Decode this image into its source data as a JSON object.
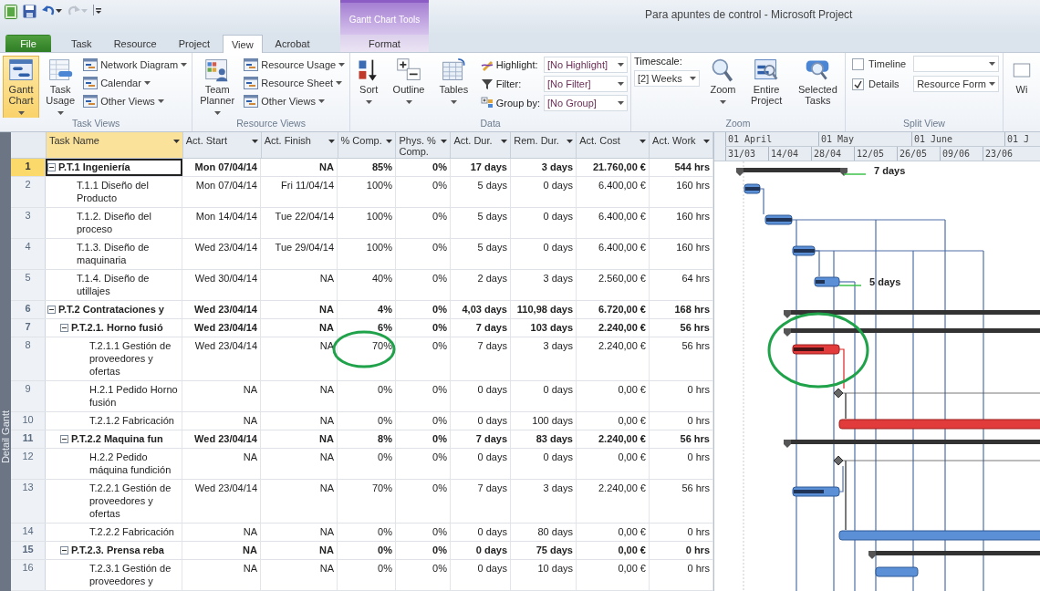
{
  "window": {
    "title": "Para apuntes de control - Microsoft Project"
  },
  "quick_access": [
    {
      "kind": "app",
      "disabled": false
    },
    {
      "kind": "save",
      "disabled": false
    },
    {
      "kind": "undo",
      "disabled": false
    },
    {
      "kind": "redo",
      "disabled": true
    },
    {
      "kind": "customize",
      "disabled": false
    }
  ],
  "context_tabs": {
    "title": "Gantt Chart Tools",
    "tabs": [
      {
        "label": "Format",
        "selected": false
      }
    ]
  },
  "tabs": [
    {
      "label": "File",
      "kind": "file",
      "selected": false
    },
    {
      "label": "Task",
      "kind": "tab",
      "selected": false
    },
    {
      "label": "Resource",
      "kind": "tab",
      "selected": false
    },
    {
      "label": "Project",
      "kind": "tab",
      "selected": false
    },
    {
      "label": "View",
      "kind": "tab",
      "selected": true
    },
    {
      "label": "Acrobat",
      "kind": "tab",
      "selected": false
    }
  ],
  "ribbon": {
    "groups": [
      {
        "label": "Task Views",
        "items": [
          {
            "kind": "large",
            "label": "Gantt Chart",
            "dropdown": true,
            "selected": true
          },
          {
            "kind": "large",
            "label": "Task Usage",
            "dropdown": true,
            "selected": false
          },
          {
            "kind": "stack",
            "items": [
              {
                "label": "Network Diagram",
                "dropdown": true
              },
              {
                "label": "Calendar",
                "dropdown": true
              },
              {
                "label": "Other Views",
                "dropdown": true
              }
            ]
          }
        ]
      },
      {
        "label": "Resource Views",
        "items": [
          {
            "kind": "large",
            "label": "Team Planner",
            "dropdown": true,
            "selected": false
          },
          {
            "kind": "stack",
            "items": [
              {
                "label": "Resource Usage",
                "dropdown": true
              },
              {
                "label": "Resource Sheet",
                "dropdown": true
              },
              {
                "label": "Other Views",
                "dropdown": true
              }
            ]
          }
        ]
      },
      {
        "label": "Data",
        "items": [
          {
            "kind": "large",
            "label": "Sort",
            "dropdown": true,
            "selected": false
          },
          {
            "kind": "large",
            "label": "Outline",
            "dropdown": true,
            "selected": false
          },
          {
            "kind": "large",
            "label": "Tables",
            "dropdown": true,
            "selected": false
          },
          {
            "kind": "fields",
            "items": [
              {
                "label": "Highlight:",
                "value": "[No Highlight]"
              },
              {
                "label": "Filter:",
                "value": "[No Filter]"
              },
              {
                "label": "Group by:",
                "value": "[No Group]"
              }
            ]
          }
        ]
      },
      {
        "label": "Zoom",
        "items": [
          {
            "kind": "field_stacked",
            "label": "Timescale:",
            "value": "[2] Weeks"
          },
          {
            "kind": "large",
            "label": "Zoom",
            "dropdown": true,
            "selected": false
          },
          {
            "kind": "large",
            "label": "Entire Project",
            "dropdown": false,
            "selected": false
          },
          {
            "kind": "large",
            "label": "Selected Tasks",
            "dropdown": false,
            "selected": false
          }
        ]
      },
      {
        "label": "Split View",
        "items": [
          {
            "kind": "checks",
            "items": [
              {
                "label": "Timeline",
                "checked": false
              },
              {
                "label": "Details",
                "checked": true,
                "value": "Resource Form"
              }
            ]
          }
        ]
      },
      {
        "items": [
          {
            "kind": "large",
            "label": "Wi",
            "dropdown": false,
            "selected": false
          }
        ]
      }
    ]
  },
  "view_bar": {
    "label": "Detail Gantt"
  },
  "table": {
    "columns": [
      {
        "label": "Task Name",
        "selected": true
      },
      {
        "label": "Act. Start",
        "selected": false
      },
      {
        "label": "Act. Finish",
        "selected": false
      },
      {
        "label": "% Comp.",
        "selected": false
      },
      {
        "label": "Phys. % Comp.",
        "selected": false
      },
      {
        "label": "Act. Dur.",
        "selected": false
      },
      {
        "label": "Rem. Dur.",
        "selected": false
      },
      {
        "label": "Act. Cost",
        "selected": false
      },
      {
        "label": "Act. Work",
        "selected": false
      }
    ],
    "rows": [
      {
        "number": "1",
        "cells": [
          "P.T.1 Ingeniería",
          "Mon 07/04/14",
          "NA",
          "85%",
          "0%",
          "17 days",
          "3 days",
          "21.760,00 €",
          "544 hrs"
        ],
        "selected": true,
        "expanded": true,
        "bar": {
          "kind": "summary",
          "critical": false,
          "label": "7 days"
        },
        "children": [
          {
            "number": "2",
            "cells": [
              "T.1.1 Diseño del Producto",
              "Mon 07/04/14",
              "Fri 11/04/14",
              "100%",
              "0%",
              "5 days",
              "0 days",
              "6.400,00 €",
              "160 hrs"
            ],
            "selected": false,
            "bar": {
              "kind": "task",
              "critical": false
            }
          },
          {
            "number": "3",
            "cells": [
              "T.1.2. Diseño del proceso",
              "Mon 14/04/14",
              "Tue 22/04/14",
              "100%",
              "0%",
              "5 days",
              "0 days",
              "6.400,00 €",
              "160 hrs"
            ],
            "selected": false,
            "bar": {
              "kind": "task",
              "critical": false
            }
          },
          {
            "number": "4",
            "cells": [
              "T.1.3. Diseño de maquinaria",
              "Wed 23/04/14",
              "Tue 29/04/14",
              "100%",
              "0%",
              "5 days",
              "0 days",
              "6.400,00 €",
              "160 hrs"
            ],
            "selected": false,
            "bar": {
              "kind": "task",
              "critical": false
            }
          },
          {
            "number": "5",
            "cells": [
              "T.1.4. Diseño de utillajes",
              "Wed 30/04/14",
              "NA",
              "40%",
              "0%",
              "2 days",
              "3 days",
              "2.560,00 €",
              "64 hrs"
            ],
            "selected": false,
            "bar": {
              "kind": "task",
              "critical": false,
              "label": "5 days"
            }
          }
        ]
      },
      {
        "number": "6",
        "cells": [
          "P.T.2 Contrataciones y",
          "Wed 23/04/14",
          "NA",
          "4%",
          "0%",
          "4,03 days",
          "110,98 days",
          "6.720,00 €",
          "168 hrs"
        ],
        "selected": false,
        "expanded": true,
        "bar": {
          "kind": "summary",
          "critical": false
        },
        "children": [
          {
            "number": "7",
            "cells": [
              "P.T.2.1. Horno fusió",
              "Wed 23/04/14",
              "NA",
              "6%",
              "0%",
              "7 days",
              "103 days",
              "2.240,00 €",
              "56 hrs"
            ],
            "selected": false,
            "expanded": true,
            "bar": {
              "kind": "summary",
              "critical": false
            },
            "children": [
              {
                "number": "8",
                "cells": [
                  "T.2.1.1 Gestión de proveedores y ofertas",
                  "Wed 23/04/14",
                  "NA",
                  "70%",
                  "0%",
                  "7 days",
                  "3 days",
                  "2.240,00 €",
                  "56 hrs"
                ],
                "selected": false,
                "circled": true,
                "bar": {
                  "kind": "task",
                  "critical": true,
                  "circled": true
                }
              },
              {
                "number": "9",
                "cells": [
                  "H.2.1 Pedido Horno fusión",
                  "NA",
                  "NA",
                  "0%",
                  "0%",
                  "0 days",
                  "0 days",
                  "0,00 €",
                  "0 hrs"
                ],
                "selected": false,
                "bar": {
                  "kind": "milestone",
                  "critical": false
                }
              },
              {
                "number": "10",
                "cells": [
                  "T.2.1.2 Fabricación",
                  "NA",
                  "NA",
                  "0%",
                  "0%",
                  "0 days",
                  "100 days",
                  "0,00 €",
                  "0 hrs"
                ],
                "selected": false,
                "bar": {
                  "kind": "task",
                  "critical": true
                }
              }
            ]
          },
          {
            "number": "11",
            "cells": [
              "P.T.2.2 Maquina fun",
              "Wed 23/04/14",
              "NA",
              "8%",
              "0%",
              "7 days",
              "83 days",
              "2.240,00 €",
              "56 hrs"
            ],
            "selected": false,
            "expanded": true,
            "bar": {
              "kind": "summary",
              "critical": false
            },
            "children": [
              {
                "number": "12",
                "cells": [
                  "H.2.2 Pedido máquina fundición",
                  "NA",
                  "NA",
                  "0%",
                  "0%",
                  "0 days",
                  "0 days",
                  "0,00 €",
                  "0 hrs"
                ],
                "selected": false,
                "bar": {
                  "kind": "milestone",
                  "critical": false
                }
              },
              {
                "number": "13",
                "cells": [
                  "T.2.2.1 Gestión de proveedores y ofertas",
                  "Wed 23/04/14",
                  "NA",
                  "70%",
                  "0%",
                  "7 days",
                  "3 days",
                  "2.240,00 €",
                  "56 hrs"
                ],
                "selected": false,
                "bar": {
                  "kind": "task",
                  "critical": false
                }
              },
              {
                "number": "14",
                "cells": [
                  "T.2.2.2 Fabricación",
                  "NA",
                  "NA",
                  "0%",
                  "0%",
                  "0 days",
                  "80 days",
                  "0,00 €",
                  "0 hrs"
                ],
                "selected": false,
                "bar": {
                  "kind": "task",
                  "critical": false
                }
              }
            ]
          },
          {
            "number": "15",
            "cells": [
              "P.T.2.3. Prensa reba",
              "NA",
              "NA",
              "0%",
              "0%",
              "0 days",
              "75 days",
              "0,00 €",
              "0 hrs"
            ],
            "selected": false,
            "expanded": true,
            "bar": {
              "kind": "summary",
              "critical": false
            },
            "children": [
              {
                "number": "16",
                "cells": [
                  "T.2.3.1 Gestión de proveedores y",
                  "NA",
                  "NA",
                  "0%",
                  "0%",
                  "0 days",
                  "10 days",
                  "0,00 €",
                  "0 hrs"
                ],
                "selected": false,
                "bar": {
                  "kind": "task",
                  "critical": false
                }
              }
            ]
          }
        ]
      }
    ]
  },
  "timescale": {
    "months": [
      "01 April",
      "01 May",
      "01 June",
      "01 J"
    ],
    "weeks": [
      "31/03",
      "14/04",
      "28/04",
      "12/05",
      "26/05",
      "09/06",
      "23/06"
    ]
  }
}
